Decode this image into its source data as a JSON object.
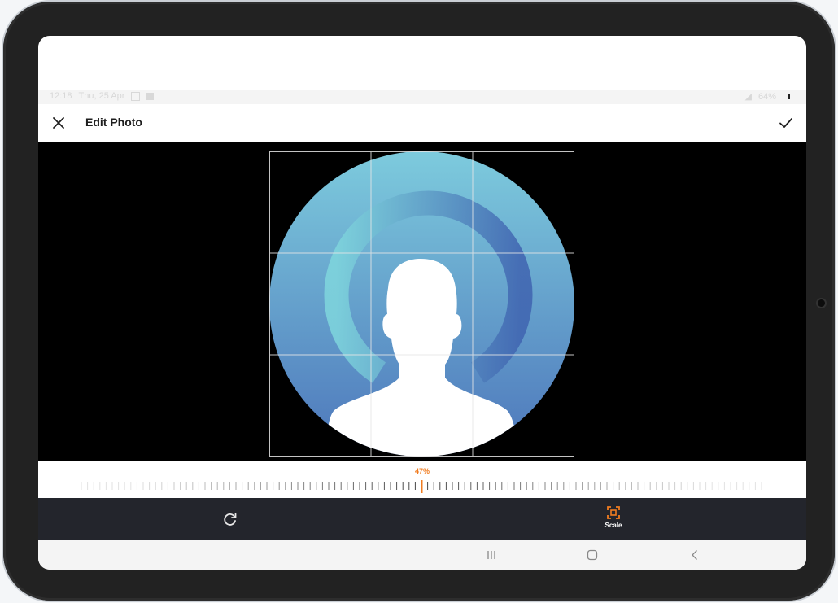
{
  "status_bar": {
    "time": "12:18",
    "date": "Thu, 25 Apr",
    "battery": "64%"
  },
  "app_bar": {
    "title": "Edit Photo",
    "close_icon": "close-icon",
    "confirm_icon": "checkmark-icon"
  },
  "editor": {
    "crop_grid": "3x3",
    "image": "default-avatar-silhouette",
    "colors": {
      "gradient_top": "#7dcbdd",
      "gradient_bottom": "#4d76bb",
      "arc": "#5b89c6",
      "silhouette": "#ffffff"
    }
  },
  "scale_slider": {
    "value_label": "47%",
    "value": 47,
    "accent_color": "#f07c20"
  },
  "toolbar": {
    "rotate_icon": "rotate-icon",
    "scale_icon": "scale-icon",
    "scale_label": "Scale"
  },
  "nav_bar": {
    "recents_icon": "recents-icon",
    "home_icon": "home-icon",
    "back_icon": "back-icon"
  }
}
